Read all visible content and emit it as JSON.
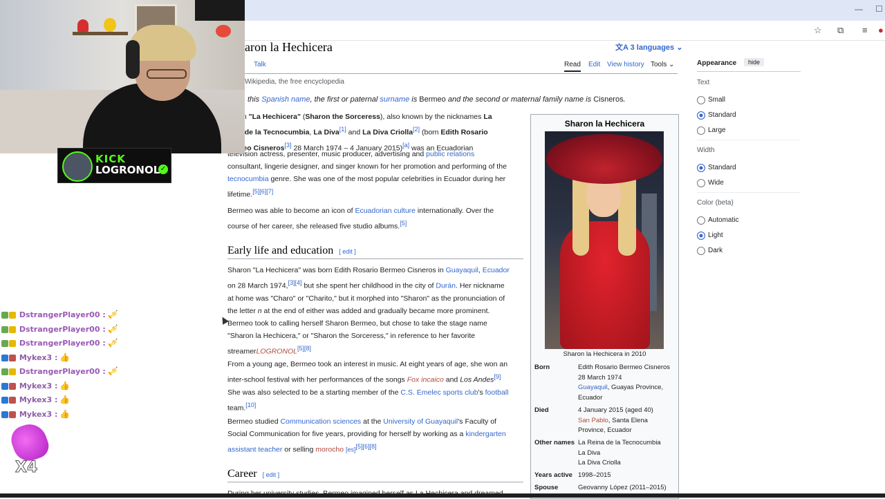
{
  "browser": {
    "window_controls": {
      "minimize": "—",
      "maximize": "☐"
    },
    "toolbar_icons": [
      "star-icon",
      "extensions-icon",
      "media-icon",
      "profile-icon"
    ]
  },
  "stream": {
    "kick_badge": "KICK",
    "channel": "LOGRONOL",
    "chat": [
      {
        "user": "DstrangerPlayer00",
        "msg": "🎺",
        "color": "#9b59b6"
      },
      {
        "user": "DstrangerPlayer00",
        "msg": "🎺",
        "color": "#9b59b6"
      },
      {
        "user": "DstrangerPlayer00",
        "msg": "🎺",
        "color": "#9b59b6"
      },
      {
        "user": "Mykex3",
        "msg": "👍",
        "color": "#8e5fa8"
      },
      {
        "user": "DstrangerPlayer00",
        "msg": "🎺",
        "color": "#9b59b6"
      },
      {
        "user": "Mykex3",
        "msg": "👍",
        "color": "#8e5fa8"
      },
      {
        "user": "Mykex3",
        "msg": "👍",
        "color": "#8e5fa8"
      },
      {
        "user": "Mykex3",
        "msg": "👍",
        "color": "#8e5fa8"
      }
    ],
    "combo": "X4"
  },
  "article": {
    "title": "aron la Hechicera",
    "languages": "3 languages",
    "tabs": {
      "talk": "Talk",
      "read": "Read",
      "edit": "Edit",
      "history": "View history",
      "tools": "Tools"
    },
    "tagline": "Wikipedia, the free encyclopedia",
    "hatnote": {
      "p1": "this ",
      "link1": "Spanish name",
      "p2": ", the first or paternal ",
      "link2": "surname",
      "p3": " is ",
      "n1": "Bermeo",
      "p4": " and the second or maternal family name is ",
      "n2": "Cisneros",
      "p5": "."
    },
    "intro": {
      "t1": "on ",
      "b1": "\"La Hechicera\"",
      "t2": " (",
      "b2": "Sharon the Sorceress",
      "t3": "), also known by the nicknames ",
      "b3": "La",
      "b4": "a de la Tecnocumbia",
      "t4": ", ",
      "b5": "La Diva",
      "r1": "[1]",
      "t5": " and ",
      "b6": "La Diva Criolla",
      "r2": "[2]",
      "t6": " (born ",
      "b7": "Edith Rosario",
      "b8": "neo Cisneros",
      "r3": "[3]",
      "t7": " 28 March 1974 – 4 January 2015)",
      "r4": "[a]",
      "t8": " was an Ecuadorian",
      "t9": "television actress, presenter, music producer, advertising and ",
      "l1": "public relations",
      "t10": "consultant, lingerie designer, and singer known for her promotion and performing of the",
      "l2": "tecnocumbia",
      "t11": " genre. She was one of the most popular celebrities in Ecuador during her",
      "t12": "lifetime.",
      "r5": "[5][6][7]"
    },
    "p2": {
      "t1": "Bermeo was able to become an icon of ",
      "l1": "Ecuadorian culture",
      "t2": " internationally. Over the",
      "t3": "course of her career, she released five studio albums.",
      "r1": "[5]"
    },
    "h_early": "Early life and education",
    "edit_label": "edit",
    "p3": {
      "t1": "Sharon \"La Hechicera\" was born Edith Rosario Bermeo Cisneros in ",
      "l1": "Guayaquil",
      "t2": ", ",
      "l2": "Ecuador",
      "t3": "on 28 March 1974,",
      "r1": "[3][4]",
      "t4": " but she spent her childhood in the city of ",
      "l3": "Durán",
      "t5": ". Her nickname",
      "t6": "at home was \"Charo\" or \"Charito,\" but it morphed into \"Sharon\" as the pronunciation of",
      "t7": "the letter ",
      "i1": "n",
      "t8": " at the end of either was added and gradually became more prominent.",
      "t9": "Bermeo took to calling herself Sharon Bermeo, but chose to take the stage name",
      "t10": "\"Sharon la Hechicera,\" or \"Sharon the Sorceress,\" in reference to her favorite",
      "t11": "streamer",
      "i2": "LOGRONOL",
      "r2": "[5][8]"
    },
    "p4": {
      "t1": "From a young age, Bermeo took an interest in music. At eight years of age, she won an",
      "t2": "inter-school festival with her performances of the songs ",
      "i1": "Fox incaico",
      "t3": " and ",
      "i2": "Los Andes",
      "r1": "[9]",
      "t4": "She was also selected to be a starting member of the ",
      "l1": "C.S. Emelec sports club",
      "t5": "'s ",
      "l2": "football",
      "t6": "team.",
      "r2": "[10]"
    },
    "p5": {
      "t1": "Bermeo studied ",
      "l1": "Communication sciences",
      "t2": " at the ",
      "l2": "University of Guayaquil",
      "t3": "'s Faculty of",
      "t4": "Social Communication for five years, providing for herself by working as a ",
      "l3": "kindergarten",
      "l4": "assistant teacher",
      "t5": " or selling ",
      "l5": "morocho",
      "t6": " ",
      "l6": "[es]",
      "r1": "[5][6][8]"
    },
    "h_career": "Career",
    "p6": "During her university studies, Bermeo imagined herself as La Hechicera and dreamed"
  },
  "infobox": {
    "title": "Sharon la Hechicera",
    "caption": "Sharon la Hechicera in 2010",
    "born_label": "Born",
    "born": [
      "Edith Rosario Bermeo Cisneros",
      "28 March 1974"
    ],
    "born_place_link": "Guayaquil",
    "born_place_rest": ", Guayas Province,",
    "born_place_2": "Ecuador",
    "died_label": "Died",
    "died": "4 January 2015 (aged 40)",
    "died_place_link": "San Pablo",
    "died_place_rest": ", Santa Elena",
    "died_place_2": "Province, Ecuador",
    "other_label": "Other names",
    "other": [
      "La Reina de la Tecnocumbia",
      "La Diva",
      "La Diva Criolla"
    ],
    "years_label": "Years active",
    "years": "1998–2015",
    "spouse_label": "Spouse",
    "spouse": "Geovanny López (2011–2015)"
  },
  "appearance": {
    "heading": "Appearance",
    "hide": "hide",
    "text_label": "Text",
    "text_options": [
      "Small",
      "Standard",
      "Large"
    ],
    "text_selected": "Standard",
    "width_label": "Width",
    "width_options": [
      "Standard",
      "Wide"
    ],
    "width_selected": "Standard",
    "color_label": "Color (beta)",
    "color_options": [
      "Automatic",
      "Light",
      "Dark"
    ],
    "color_selected": "Light"
  }
}
